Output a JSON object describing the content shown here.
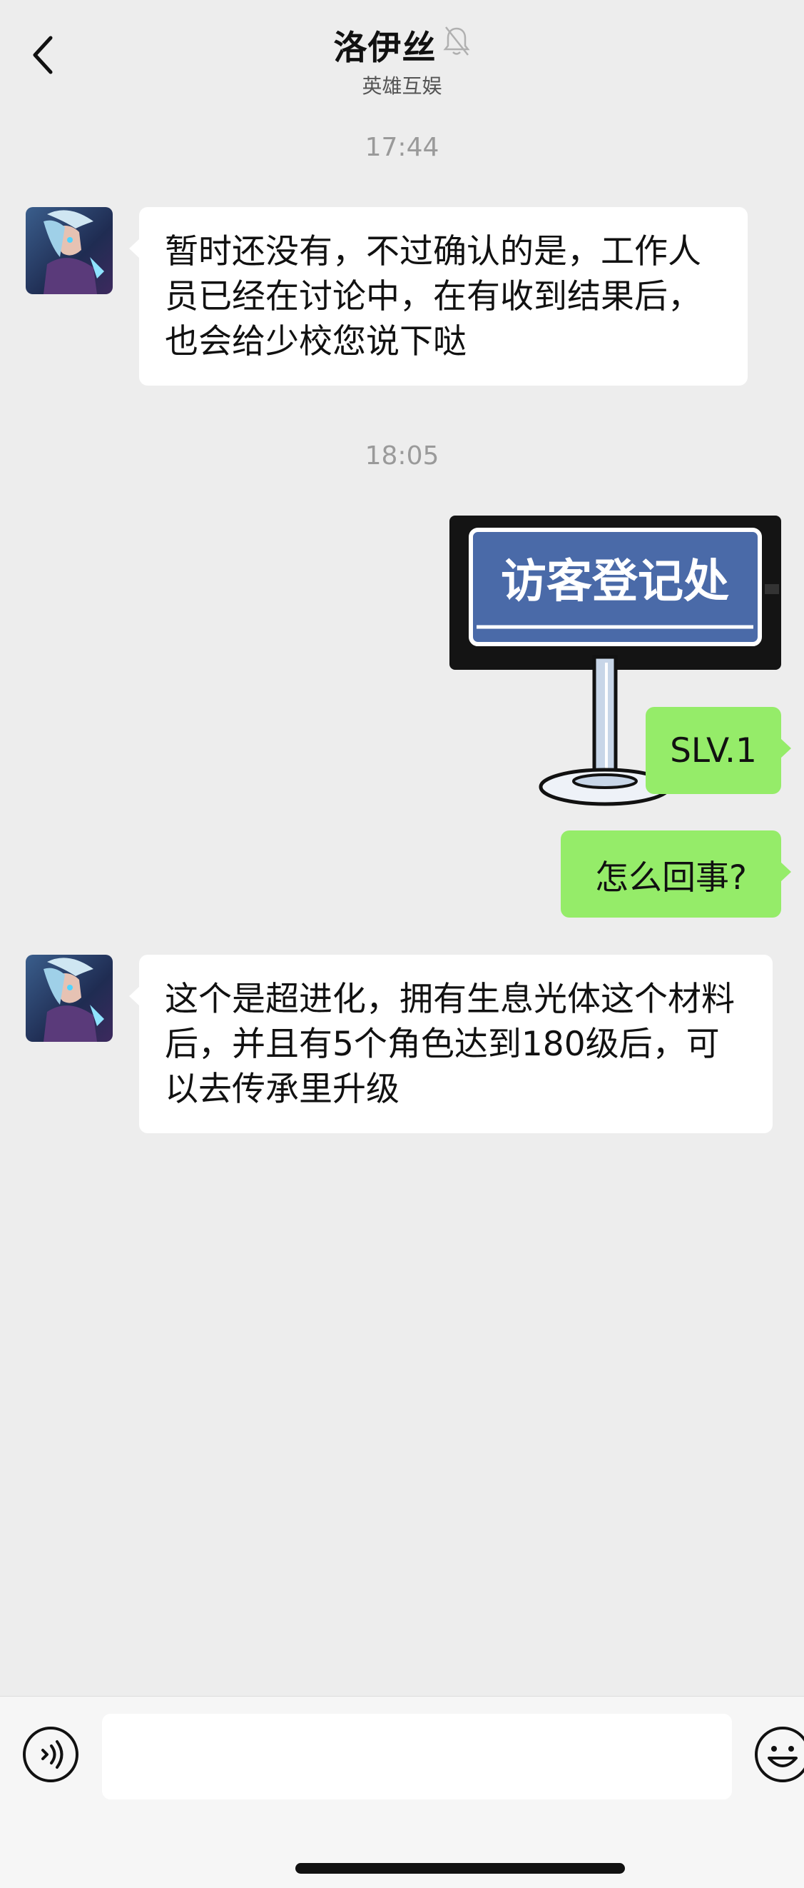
{
  "header": {
    "title": "洛伊丝",
    "subtitle": "英雄互娱",
    "back_icon": "chevron-left-icon",
    "mute_icon": "bell-off-icon"
  },
  "messages": [
    {
      "type": "timestamp",
      "text": "17:44"
    },
    {
      "type": "incoming",
      "text": "暂时还没有，不过确认的是，工作人员已经在讨论中，在有收到结果后，也会给少校您说下哒"
    },
    {
      "type": "timestamp",
      "text": "18:05"
    },
    {
      "type": "outgoing-sticker",
      "text": "访客登记处"
    },
    {
      "type": "outgoing",
      "text": "SLV.1"
    },
    {
      "type": "outgoing",
      "text": "怎么回事?"
    },
    {
      "type": "incoming",
      "text": "这个是超进化，拥有生息光体这个材料后，并且有5个角色达到180级后，可以去传承里升级"
    }
  ],
  "composer": {
    "input_value": "",
    "voice_icon": "voice-icon",
    "emoji_icon": "emoji-icon"
  },
  "colors": {
    "background": "#ededed",
    "incoming_bubble": "#ffffff",
    "outgoing_bubble": "#95ec69",
    "timestamp": "#9a9a9a"
  }
}
